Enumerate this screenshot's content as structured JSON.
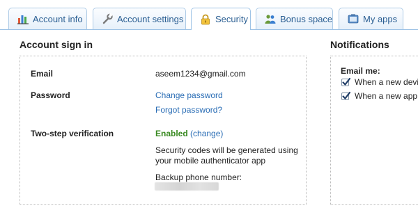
{
  "tabs": [
    {
      "label": "Account info",
      "icon": "bar-chart-icon"
    },
    {
      "label": "Account settings",
      "icon": "wrench-icon"
    },
    {
      "label": "Security",
      "icon": "padlock-icon",
      "active": true
    },
    {
      "label": "Bonus space",
      "icon": "users-icon"
    },
    {
      "label": "My apps",
      "icon": "apps-box-icon"
    }
  ],
  "account_signin": {
    "title": "Account sign in",
    "email_label": "Email",
    "email_value": "aseem1234@gmail.com",
    "password_label": "Password",
    "change_password": "Change password",
    "forgot_password": "Forgot password?",
    "two_step_label": "Two-step verification",
    "two_step_status": "Enabled",
    "two_step_change": "(change)",
    "codes_line1": "Security codes will be generated using",
    "codes_line2": "your mobile authenticator app",
    "backup_phone_label": "Backup phone number:"
  },
  "notifications": {
    "title": "Notifications",
    "email_me_label": "Email me:",
    "options": [
      {
        "label": "When a new devi",
        "checked": true
      },
      {
        "label": "When a new app",
        "checked": true
      }
    ]
  },
  "colors": {
    "tab_text": "#2b5f93",
    "link": "#2a6db5",
    "enabled": "#3a8a22"
  }
}
